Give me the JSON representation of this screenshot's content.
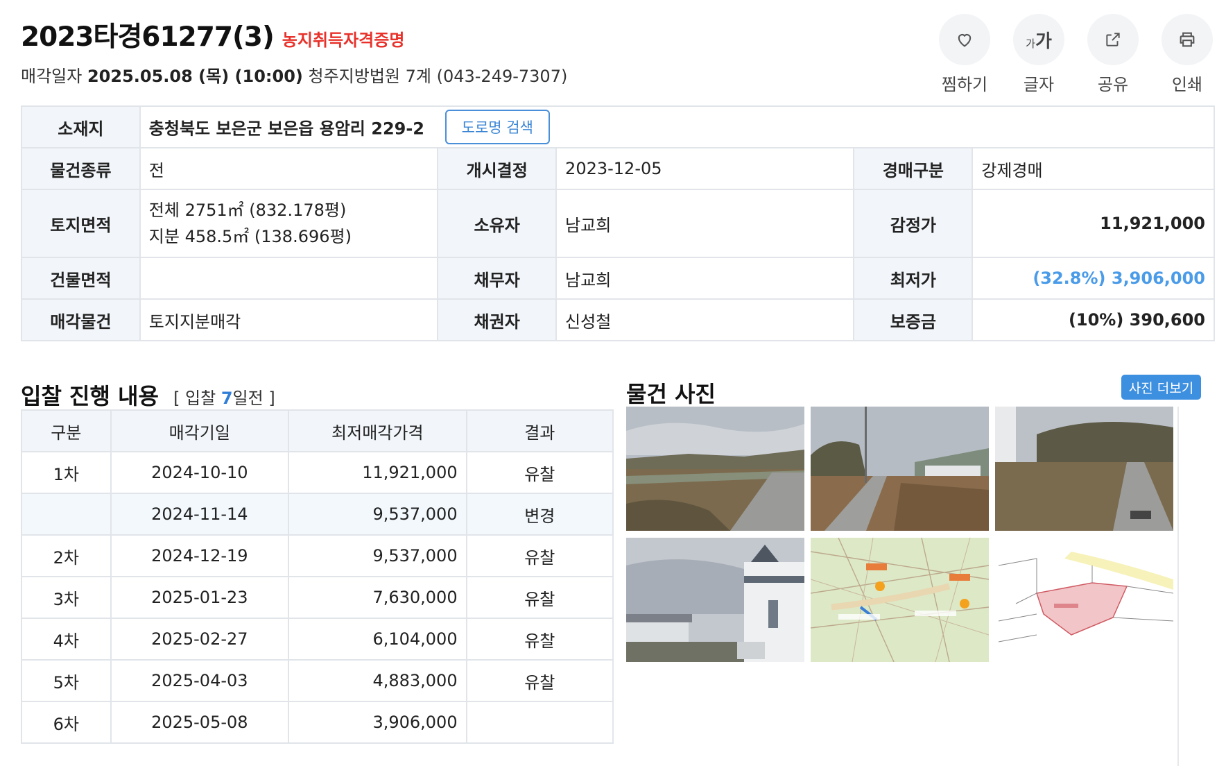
{
  "header": {
    "case_no": "2023타경61277(3)",
    "farm_tag": "농지취득자격증명",
    "sale_label": "매각일자",
    "sale_datetime": "2025.05.08 (목) (10:00)",
    "court": "청주지방법원 7계 (043-249-7307)"
  },
  "actions": [
    {
      "label": "찜하기",
      "icon": "heart-icon"
    },
    {
      "label": "글자",
      "icon": "font-size-icon",
      "glyph_small": "가",
      "glyph_big": "가"
    },
    {
      "label": "공유",
      "icon": "share-icon"
    },
    {
      "label": "인쇄",
      "icon": "print-icon"
    }
  ],
  "info": {
    "location_label": "소재지",
    "location": "충청북도 보은군 보은읍 용암리 229-2",
    "road_search": "도로명 검색",
    "rows": [
      {
        "l1": "물건종류",
        "v1": "전",
        "l2": "개시결정",
        "v2": "2023-12-05",
        "l3": "경매구분",
        "v3": "강제경매"
      },
      {
        "l1": "토지면적",
        "v1a": "전체 2751㎡ (832.178평)",
        "v1b": "지분 458.5㎡ (138.696평)",
        "l2": "소유자",
        "v2": "남교희",
        "l3": "감정가",
        "v3": "11,921,000"
      },
      {
        "l1": "건물면적",
        "v1": "",
        "l2": "채무자",
        "v2": "남교희",
        "l3": "최저가",
        "v3": "(32.8%) 3,906,000"
      },
      {
        "l1": "매각물건",
        "v1": "토지지분매각",
        "l2": "채권자",
        "v2": "신성철",
        "l3": "보증금",
        "v3": "(10%) 390,600"
      }
    ]
  },
  "bidding": {
    "title": "입찰 진행 내용",
    "sub_open": "[ 입찰 ",
    "days": "7",
    "sub_close": "일전 ]",
    "headers": [
      "구분",
      "매각기일",
      "최저매각가격",
      "결과"
    ],
    "rows": [
      {
        "round": "1차",
        "date": "2024-10-10",
        "price": "11,921,000",
        "result": "유찰"
      },
      {
        "round": "",
        "date": "2024-11-14",
        "price": "9,537,000",
        "result": "변경"
      },
      {
        "round": "2차",
        "date": "2024-12-19",
        "price": "9,537,000",
        "result": "유찰"
      },
      {
        "round": "3차",
        "date": "2025-01-23",
        "price": "7,630,000",
        "result": "유찰"
      },
      {
        "round": "4차",
        "date": "2025-02-27",
        "price": "6,104,000",
        "result": "유찰"
      },
      {
        "round": "5차",
        "date": "2025-04-03",
        "price": "4,883,000",
        "result": "유찰"
      },
      {
        "round": "6차",
        "date": "2025-05-08",
        "price": "3,906,000",
        "result": ""
      }
    ]
  },
  "photos": {
    "title": "물건 사진",
    "more": "사진 더보기",
    "colors": {
      "sky": "#b9c0c9",
      "field": "#7d6a4c",
      "road": "#9a9a98",
      "map_bg": "#dfe9c9",
      "plot": "#f2c6c8"
    }
  }
}
